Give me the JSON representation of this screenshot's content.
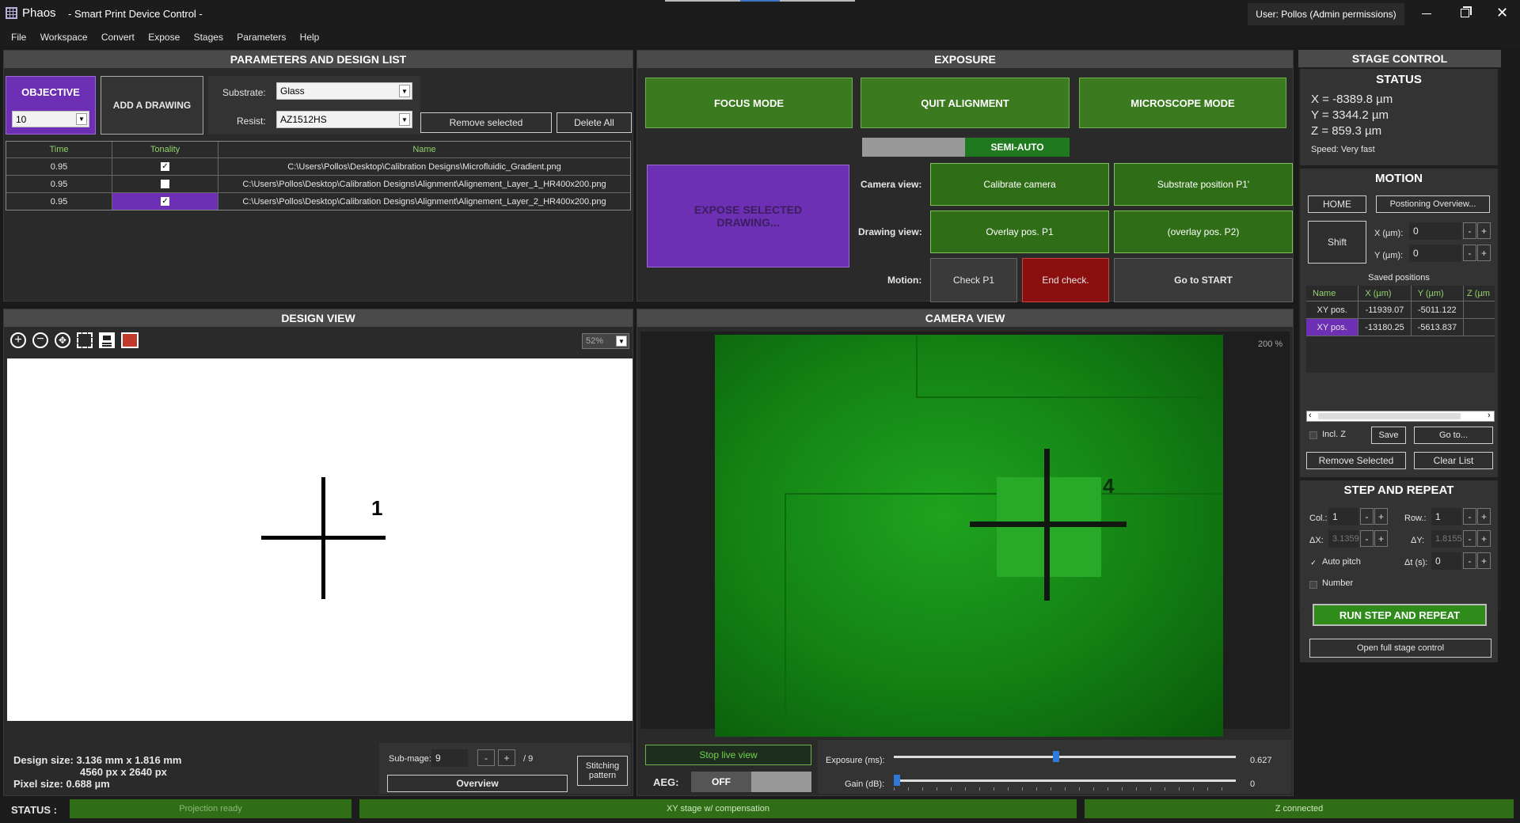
{
  "titlebar": {
    "app_name": "Phaos",
    "title": "- Smart Print Device Control -",
    "user": "User: Pollos (Admin permissions)"
  },
  "menu": [
    "File",
    "Workspace",
    "Convert",
    "Expose",
    "Stages",
    "Parameters",
    "Help"
  ],
  "params": {
    "header": "PARAMETERS AND DESIGN LIST",
    "objective_label": "OBJECTIVE",
    "objective_value": "10",
    "add_drawing": "ADD A DRAWING",
    "substrate_label": "Substrate:",
    "substrate_value": "Glass",
    "resist_label": "Resist:",
    "resist_value": "AZ1512HS",
    "remove_selected": "Remove selected",
    "delete_all": "Delete All",
    "columns": [
      "Time",
      "Tonality",
      "Name"
    ],
    "rows": [
      {
        "time": "0.95",
        "checked": true,
        "name": "C:\\Users\\Pollos\\Desktop\\Calibration Designs\\Microfluidic_Gradient.png"
      },
      {
        "time": "0.95",
        "checked": false,
        "name": "C:\\Users\\Pollos\\Desktop\\Calibration Designs\\Alignment\\Alignement_Layer_1_HR400x200.png"
      },
      {
        "time": "0.95",
        "checked": true,
        "name": "C:\\Users\\Pollos\\Desktop\\Calibration Designs\\Alignment\\Alignement_Layer_2_HR400x200.png"
      }
    ]
  },
  "exposure": {
    "header": "EXPOSURE",
    "focus_mode": "FOCUS MODE",
    "quit_alignment": "QUIT ALIGNMENT",
    "microscope_mode": "MICROSCOPE MODE",
    "mode_toggle": "SEMI-AUTO",
    "expose_selected": "EXPOSE SELECTED DRAWING...",
    "camera_view_label": "Camera view:",
    "calibrate_camera": "Calibrate camera",
    "substrate_position": "Substrate position P1'",
    "drawing_view_label": "Drawing view:",
    "overlay_p1": "Overlay pos. P1",
    "overlay_p2": "(overlay pos. P2)",
    "motion_label": "Motion:",
    "check_p1": "Check P1",
    "end_check": "End check.",
    "go_to_start": "Go to START"
  },
  "stage": {
    "header": "STAGE CONTROL",
    "status_title": "STATUS",
    "x": "X = -8389.8 µm",
    "y": "Y = 3344.2 µm",
    "z": "Z = 859.3 µm",
    "speed": "Speed: Very fast",
    "motion_title": "MOTION",
    "home": "HOME",
    "positioning_overview": "Postioning Overview...",
    "shift": "Shift",
    "x_label": "X (µm):",
    "x_value": "0",
    "y_label": "Y (µm):",
    "y_value": "0",
    "saved_positions": "Saved positions",
    "saved_columns": [
      "Name",
      "X (µm)",
      "Y (µm)",
      "Z (µm"
    ],
    "saved_rows": [
      {
        "name": "XY pos.",
        "x": "-11939.07",
        "y": "-5011.122",
        "z": ""
      },
      {
        "name": "XY pos.",
        "x": "-13180.25",
        "y": "-5613.837",
        "z": ""
      }
    ],
    "incl_z": "Incl. Z",
    "save": "Save",
    "go_to": "Go to...",
    "remove_selected": "Remove Selected",
    "clear_list": "Clear List",
    "step_title": "STEP AND REPEAT",
    "col_label": "Col.:",
    "col_value": "1",
    "row_label": "Row.:",
    "row_value": "1",
    "dx_label": "ΔX:",
    "dx_value": "3.1359",
    "dy_label": "ΔY:",
    "dy_value": "1.8155",
    "auto_pitch": "Auto pitch",
    "dt_label": "Δt (s):",
    "dt_value": "0",
    "number": "Number",
    "run_step": "RUN STEP AND REPEAT",
    "open_full": "Open full stage control"
  },
  "design": {
    "header": "DESIGN VIEW",
    "zoom": "52%",
    "marker_label": "1",
    "size_line1": "Design size: 3.136 mm x 1.816 mm",
    "size_line2": "4560 px x 2640 px",
    "pixel_size": "Pixel size: 0.688 µm",
    "subimage_label": "Sub-mage:",
    "subimage_value": "9",
    "subimage_total": "/ 9",
    "overview": "Overview",
    "stitching": "Stitching pattern"
  },
  "camera": {
    "header": "CAMERA VIEW",
    "zoom": "200 %",
    "marker_label": "4",
    "stop_live": "Stop live view",
    "aeg_label": "AEG:",
    "aeg_value": "OFF",
    "exposure_label": "Exposure (ms):",
    "exposure_value": "0.627",
    "exposure_fraction": 0.465,
    "gain_label": "Gain (dB):",
    "gain_value": "0",
    "gain_fraction": 0.0
  },
  "statusbar": {
    "label": "STATUS :",
    "projection": "Projection ready",
    "xy": "XY stage w/ compensation",
    "z": "Z connected"
  },
  "colors": {
    "accent_purple": "#6d2fb3",
    "accent_green": "#3b7a1e",
    "end_check_red": "#8b0f0f"
  }
}
